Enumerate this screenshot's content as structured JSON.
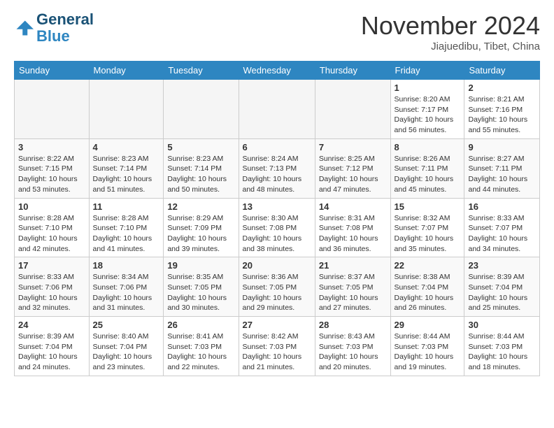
{
  "header": {
    "logo_line1": "General",
    "logo_line2": "Blue",
    "month_year": "November 2024",
    "location": "Jiajuedibu, Tibet, China"
  },
  "weekdays": [
    "Sunday",
    "Monday",
    "Tuesday",
    "Wednesday",
    "Thursday",
    "Friday",
    "Saturday"
  ],
  "weeks": [
    [
      {
        "day": "",
        "detail": ""
      },
      {
        "day": "",
        "detail": ""
      },
      {
        "day": "",
        "detail": ""
      },
      {
        "day": "",
        "detail": ""
      },
      {
        "day": "",
        "detail": ""
      },
      {
        "day": "1",
        "detail": "Sunrise: 8:20 AM\nSunset: 7:17 PM\nDaylight: 10 hours and 56 minutes."
      },
      {
        "day": "2",
        "detail": "Sunrise: 8:21 AM\nSunset: 7:16 PM\nDaylight: 10 hours and 55 minutes."
      }
    ],
    [
      {
        "day": "3",
        "detail": "Sunrise: 8:22 AM\nSunset: 7:15 PM\nDaylight: 10 hours and 53 minutes."
      },
      {
        "day": "4",
        "detail": "Sunrise: 8:23 AM\nSunset: 7:14 PM\nDaylight: 10 hours and 51 minutes."
      },
      {
        "day": "5",
        "detail": "Sunrise: 8:23 AM\nSunset: 7:14 PM\nDaylight: 10 hours and 50 minutes."
      },
      {
        "day": "6",
        "detail": "Sunrise: 8:24 AM\nSunset: 7:13 PM\nDaylight: 10 hours and 48 minutes."
      },
      {
        "day": "7",
        "detail": "Sunrise: 8:25 AM\nSunset: 7:12 PM\nDaylight: 10 hours and 47 minutes."
      },
      {
        "day": "8",
        "detail": "Sunrise: 8:26 AM\nSunset: 7:11 PM\nDaylight: 10 hours and 45 minutes."
      },
      {
        "day": "9",
        "detail": "Sunrise: 8:27 AM\nSunset: 7:11 PM\nDaylight: 10 hours and 44 minutes."
      }
    ],
    [
      {
        "day": "10",
        "detail": "Sunrise: 8:28 AM\nSunset: 7:10 PM\nDaylight: 10 hours and 42 minutes."
      },
      {
        "day": "11",
        "detail": "Sunrise: 8:28 AM\nSunset: 7:10 PM\nDaylight: 10 hours and 41 minutes."
      },
      {
        "day": "12",
        "detail": "Sunrise: 8:29 AM\nSunset: 7:09 PM\nDaylight: 10 hours and 39 minutes."
      },
      {
        "day": "13",
        "detail": "Sunrise: 8:30 AM\nSunset: 7:08 PM\nDaylight: 10 hours and 38 minutes."
      },
      {
        "day": "14",
        "detail": "Sunrise: 8:31 AM\nSunset: 7:08 PM\nDaylight: 10 hours and 36 minutes."
      },
      {
        "day": "15",
        "detail": "Sunrise: 8:32 AM\nSunset: 7:07 PM\nDaylight: 10 hours and 35 minutes."
      },
      {
        "day": "16",
        "detail": "Sunrise: 8:33 AM\nSunset: 7:07 PM\nDaylight: 10 hours and 34 minutes."
      }
    ],
    [
      {
        "day": "17",
        "detail": "Sunrise: 8:33 AM\nSunset: 7:06 PM\nDaylight: 10 hours and 32 minutes."
      },
      {
        "day": "18",
        "detail": "Sunrise: 8:34 AM\nSunset: 7:06 PM\nDaylight: 10 hours and 31 minutes."
      },
      {
        "day": "19",
        "detail": "Sunrise: 8:35 AM\nSunset: 7:05 PM\nDaylight: 10 hours and 30 minutes."
      },
      {
        "day": "20",
        "detail": "Sunrise: 8:36 AM\nSunset: 7:05 PM\nDaylight: 10 hours and 29 minutes."
      },
      {
        "day": "21",
        "detail": "Sunrise: 8:37 AM\nSunset: 7:05 PM\nDaylight: 10 hours and 27 minutes."
      },
      {
        "day": "22",
        "detail": "Sunrise: 8:38 AM\nSunset: 7:04 PM\nDaylight: 10 hours and 26 minutes."
      },
      {
        "day": "23",
        "detail": "Sunrise: 8:39 AM\nSunset: 7:04 PM\nDaylight: 10 hours and 25 minutes."
      }
    ],
    [
      {
        "day": "24",
        "detail": "Sunrise: 8:39 AM\nSunset: 7:04 PM\nDaylight: 10 hours and 24 minutes."
      },
      {
        "day": "25",
        "detail": "Sunrise: 8:40 AM\nSunset: 7:04 PM\nDaylight: 10 hours and 23 minutes."
      },
      {
        "day": "26",
        "detail": "Sunrise: 8:41 AM\nSunset: 7:03 PM\nDaylight: 10 hours and 22 minutes."
      },
      {
        "day": "27",
        "detail": "Sunrise: 8:42 AM\nSunset: 7:03 PM\nDaylight: 10 hours and 21 minutes."
      },
      {
        "day": "28",
        "detail": "Sunrise: 8:43 AM\nSunset: 7:03 PM\nDaylight: 10 hours and 20 minutes."
      },
      {
        "day": "29",
        "detail": "Sunrise: 8:44 AM\nSunset: 7:03 PM\nDaylight: 10 hours and 19 minutes."
      },
      {
        "day": "30",
        "detail": "Sunrise: 8:44 AM\nSunset: 7:03 PM\nDaylight: 10 hours and 18 minutes."
      }
    ]
  ]
}
